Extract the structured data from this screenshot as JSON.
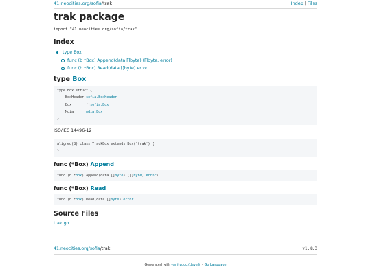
{
  "topbar": {
    "crumb_link": "41.neocities.org/sofia",
    "crumb_rest": "/trak",
    "index_link": "Index",
    "files_link": "Files",
    "separator": "|"
  },
  "page": {
    "title": "trak package",
    "import_line": "import \"41.neocities.org/sofia/trak\""
  },
  "index": {
    "heading": "Index",
    "items": [
      "type Box",
      "func (b *Box) Append(data []byte) ([]byte, error)",
      "func (b *Box) Read(data []byte) error"
    ]
  },
  "type_box": {
    "heading_prefix": "type",
    "heading_name": "Box",
    "code": {
      "line1": "type Box struct {",
      "f1_name": "BoxHeader",
      "f1_type": "sofia.BoxHeader",
      "f2_name": "Box",
      "f2_type_prefix": "[]",
      "f2_type": "sofia.Box",
      "f3_name": "Mdia",
      "f3_type": "mdia.Box",
      "close": "}"
    },
    "spec_text": "ISO/IEC 14496-12",
    "spec_code": "aligned(8) class TrackBox extends Box('trak') {",
    "spec_close": "}"
  },
  "append": {
    "heading_prefix": "func (*Box)",
    "heading_name": "Append",
    "sig_a": "func (b *",
    "sig_box": "Box",
    "sig_b": ") Append(data []",
    "sig_byte": "byte",
    "sig_c": ") ([]",
    "sig_byte2": "byte",
    "sig_d": ", ",
    "sig_error": "error",
    "sig_e": ")"
  },
  "read": {
    "heading_prefix": "func (*Box)",
    "heading_name": "Read",
    "sig_a": "func (b *",
    "sig_box": "Box",
    "sig_b": ") Read(data []",
    "sig_byte": "byte",
    "sig_c": ") ",
    "sig_error": "error"
  },
  "source_files": {
    "heading": "Source Files",
    "file": "trak.go"
  },
  "footer": {
    "crumb_link": "41.neocities.org/sofia",
    "crumb_rest": "/trak",
    "version": "v1.8.3",
    "generated_prefix": "Generated with",
    "generator_link": "vanitydoc (devel)",
    "dot": "·",
    "go_link": "Go Language"
  },
  "colors": {
    "link": "#007d9c",
    "code_bg": "#f4f6f8"
  }
}
